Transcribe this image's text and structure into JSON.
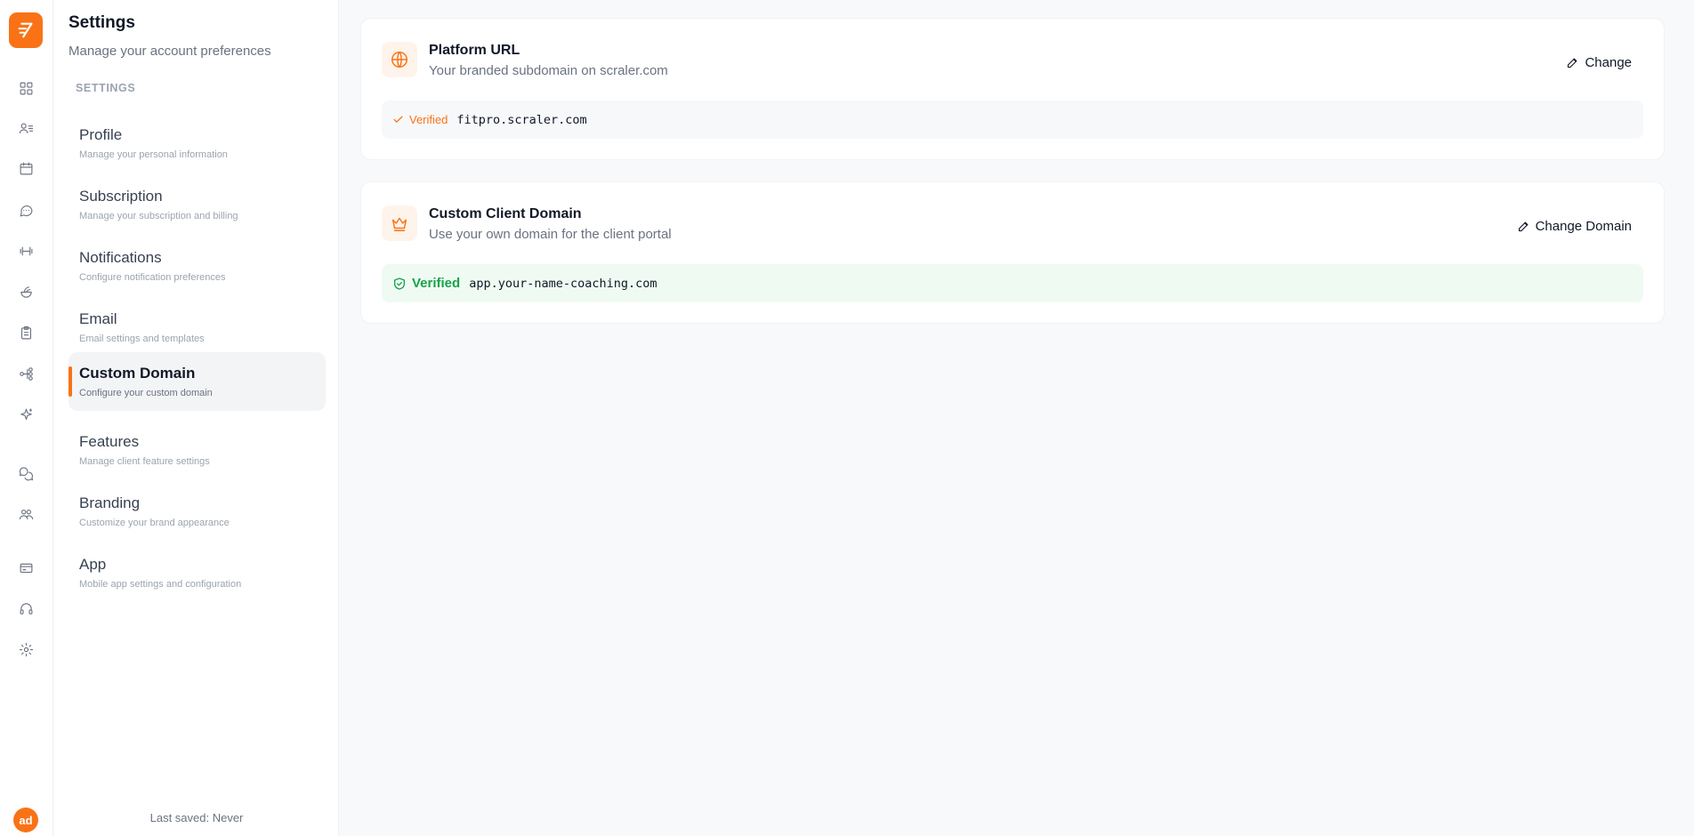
{
  "rail": {
    "icons": [
      "dashboard-icon",
      "clients-icon",
      "calendar-icon",
      "chat-icon",
      "workouts-icon",
      "nutrition-icon",
      "clipboard-icon",
      "automation-icon",
      "ai-sparkle-icon",
      "community-icon",
      "team-icon",
      "billing-icon",
      "support-icon",
      "settings-icon"
    ],
    "avatar_initials": "ad"
  },
  "panel": {
    "title": "Settings",
    "subtitle": "Manage your account preferences",
    "section_label": "SETTINGS",
    "items": [
      {
        "label": "Profile",
        "desc": "Manage your personal information"
      },
      {
        "label": "Subscription",
        "desc": "Manage your subscription and billing"
      },
      {
        "label": "Notifications",
        "desc": "Configure notification preferences"
      },
      {
        "label": "Email",
        "desc": "Email settings and templates"
      },
      {
        "label": "Custom Domain",
        "desc": "Configure your custom domain"
      },
      {
        "label": "Features",
        "desc": "Manage client feature settings"
      },
      {
        "label": "Branding",
        "desc": "Customize your brand appearance"
      },
      {
        "label": "App",
        "desc": "Mobile app settings and configuration"
      }
    ],
    "active_item": "Custom Domain",
    "last_saved": "Last saved: Never"
  },
  "platform_url": {
    "title": "Platform URL",
    "subtitle": "Your branded subdomain on scraler.com",
    "button": "Change",
    "status": "Verified",
    "domain": "fitpro.scraler.com"
  },
  "custom_domain": {
    "title": "Custom Client Domain",
    "subtitle": "Use your own domain for the client portal",
    "button": "Change Domain",
    "status": "Verified",
    "domain": "app.your-name-coaching.com"
  },
  "colors": {
    "accent": "#f97316",
    "success": "#16a34a"
  }
}
